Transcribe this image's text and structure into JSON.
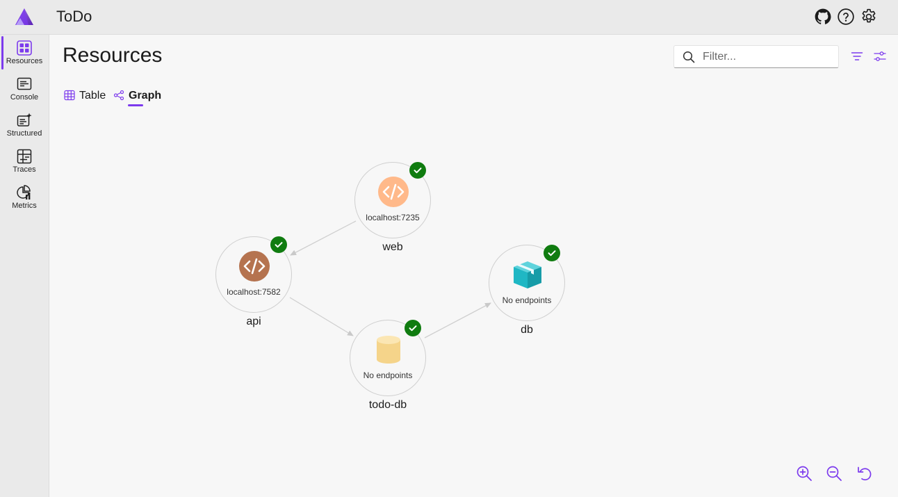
{
  "app": {
    "title": "ToDo",
    "accent": "#7c3aed"
  },
  "header_icons": [
    "github-icon",
    "help-icon",
    "gear-icon"
  ],
  "sidebar": {
    "items": [
      {
        "label": "Resources",
        "icon": "grid-icon",
        "active": true
      },
      {
        "label": "Console",
        "icon": "console-icon"
      },
      {
        "label": "Structured",
        "icon": "structured-logs-icon"
      },
      {
        "label": "Traces",
        "icon": "traces-icon"
      },
      {
        "label": "Metrics",
        "icon": "metrics-icon"
      }
    ]
  },
  "main": {
    "title": "Resources",
    "filter": {
      "placeholder": "Filter...",
      "value": ""
    },
    "tabs": [
      {
        "label": "Table",
        "icon": "table-icon"
      },
      {
        "label": "Graph",
        "icon": "graph-icon",
        "active": true
      }
    ]
  },
  "graph": {
    "nodes": [
      {
        "id": "web",
        "name": "web",
        "endpoint": "localhost:7235",
        "icon": "code-icon",
        "icon_color": "#ffb98a",
        "status": "running"
      },
      {
        "id": "api",
        "name": "api",
        "endpoint": "localhost:7582",
        "icon": "code-icon",
        "icon_color": "#b5734f",
        "status": "running"
      },
      {
        "id": "todo-db",
        "name": "todo-db",
        "endpoint": "No endpoints",
        "icon": "database-icon",
        "icon_color": "#f5d48a",
        "status": "running"
      },
      {
        "id": "db",
        "name": "db",
        "endpoint": "No endpoints",
        "icon": "package-icon",
        "icon_color": "#1fb7c4",
        "status": "running"
      }
    ],
    "edges": [
      {
        "from": "web",
        "to": "api"
      },
      {
        "from": "api",
        "to": "todo-db"
      },
      {
        "from": "todo-db",
        "to": "db"
      }
    ],
    "status_color": "#107c10"
  },
  "zoom_controls": [
    "zoom-in-icon",
    "zoom-out-icon",
    "reset-icon"
  ]
}
